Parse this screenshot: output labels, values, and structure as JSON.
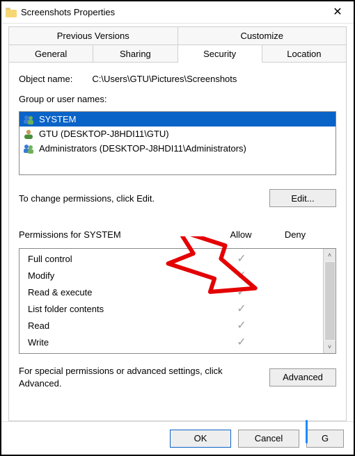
{
  "window": {
    "title": "Screenshots Properties"
  },
  "tabs": {
    "row1": [
      "Previous Versions",
      "Customize"
    ],
    "row2": [
      "General",
      "Sharing",
      "Security",
      "Location"
    ],
    "active": "Security"
  },
  "object_name": {
    "label": "Object name:",
    "value": "C:\\Users\\GTU\\Pictures\\Screenshots"
  },
  "group_label": "Group or user names:",
  "users": [
    {
      "icon": "group",
      "name": "SYSTEM",
      "selected": true
    },
    {
      "icon": "user",
      "name": "GTU (DESKTOP-J8HDI11\\GTU)",
      "selected": false
    },
    {
      "icon": "group",
      "name": "Administrators (DESKTOP-J8HDI11\\Administrators)",
      "selected": false
    }
  ],
  "edit_hint": "To change permissions, click Edit.",
  "buttons": {
    "edit": "Edit...",
    "advanced": "Advanced",
    "ok": "OK",
    "cancel": "Cancel",
    "apply_trunc": "G"
  },
  "perm_header": {
    "label_prefix": "Permissions for ",
    "principal": "SYSTEM",
    "allow": "Allow",
    "deny": "Deny"
  },
  "permissions": [
    {
      "name": "Full control",
      "allow": true,
      "deny": false
    },
    {
      "name": "Modify",
      "allow": true,
      "deny": false
    },
    {
      "name": "Read & execute",
      "allow": true,
      "deny": false
    },
    {
      "name": "List folder contents",
      "allow": true,
      "deny": false
    },
    {
      "name": "Read",
      "allow": true,
      "deny": false
    },
    {
      "name": "Write",
      "allow": true,
      "deny": false
    }
  ],
  "advanced_hint": "For special permissions or advanced settings, click Advanced.",
  "annotation": {
    "arrow_color": "#e40000"
  }
}
